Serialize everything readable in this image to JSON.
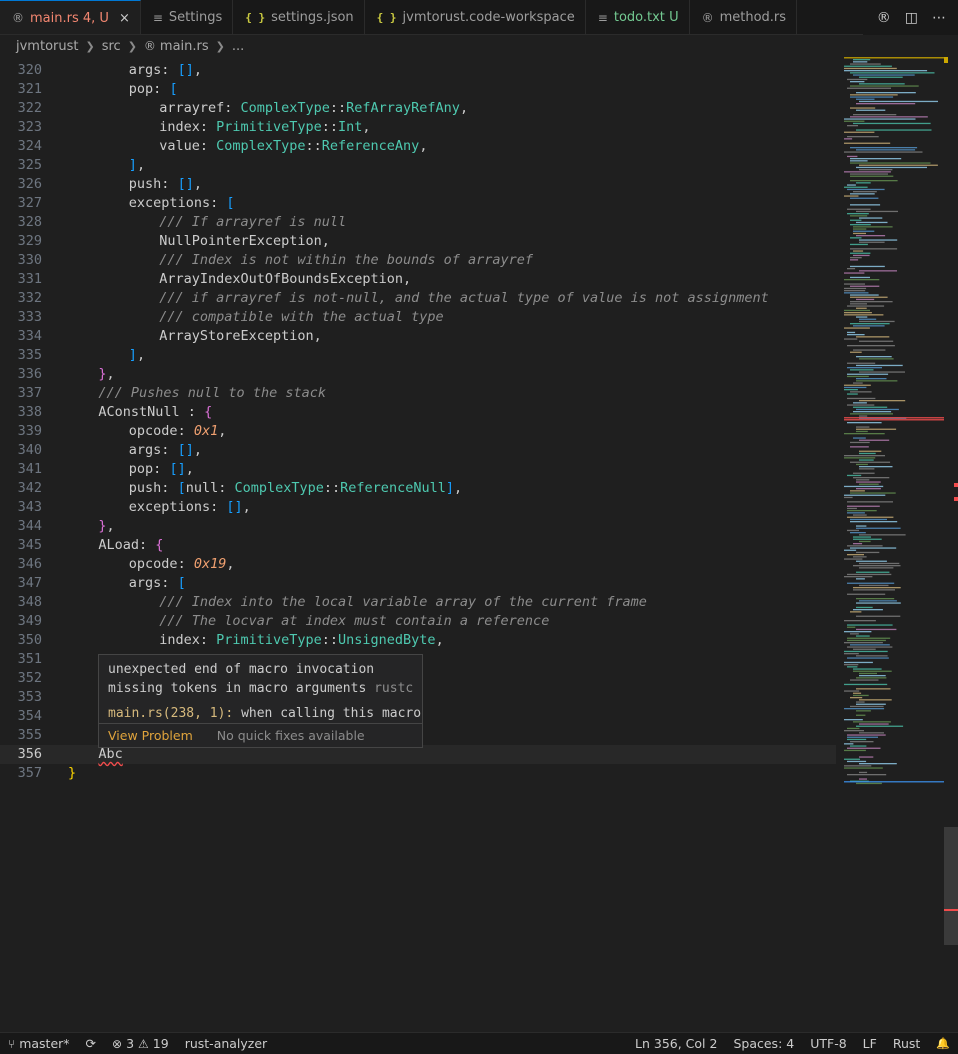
{
  "tabs": [
    {
      "icon": "rust-icon",
      "label": "main.rs",
      "badge": "4, U",
      "active": true,
      "close": "×"
    },
    {
      "icon": "settings-list-icon",
      "label": "Settings"
    },
    {
      "icon": "json-icon",
      "label": "settings.json"
    },
    {
      "icon": "json-icon",
      "label": "jvmtorust.code-workspace"
    },
    {
      "icon": "list-icon",
      "label": "todo.txt",
      "badge": "U"
    },
    {
      "icon": "rust-icon",
      "label": "method.rs"
    }
  ],
  "breadcrumb": {
    "items": [
      "jvmtorust",
      "src",
      "main.rs",
      "..."
    ]
  },
  "editor": {
    "current_line": 356,
    "lines": [
      {
        "n": "320",
        "indent": 8,
        "segs": [
          [
            "k",
            "args: "
          ],
          [
            "p2",
            "[]"
          ],
          [
            "k",
            ","
          ]
        ]
      },
      {
        "n": "321",
        "indent": 8,
        "segs": [
          [
            "k",
            "pop: "
          ],
          [
            "p2",
            "["
          ]
        ]
      },
      {
        "n": "322",
        "indent": 12,
        "segs": [
          [
            "k",
            "arrayref: "
          ],
          [
            "ty",
            "ComplexType"
          ],
          [
            "k",
            "::"
          ],
          [
            "ty",
            "RefArrayRefAny"
          ],
          [
            "k",
            ","
          ]
        ]
      },
      {
        "n": "323",
        "indent": 12,
        "segs": [
          [
            "k",
            "index: "
          ],
          [
            "ty",
            "PrimitiveType"
          ],
          [
            "k",
            "::"
          ],
          [
            "ty",
            "Int"
          ],
          [
            "k",
            ","
          ]
        ]
      },
      {
        "n": "324",
        "indent": 12,
        "segs": [
          [
            "k",
            "value: "
          ],
          [
            "ty",
            "ComplexType"
          ],
          [
            "k",
            "::"
          ],
          [
            "ty",
            "ReferenceAny"
          ],
          [
            "k",
            ","
          ]
        ]
      },
      {
        "n": "325",
        "indent": 8,
        "segs": [
          [
            "p2",
            "]"
          ],
          [
            "k",
            ","
          ]
        ]
      },
      {
        "n": "326",
        "indent": 8,
        "segs": [
          [
            "k",
            "push: "
          ],
          [
            "p2",
            "[]"
          ],
          [
            "k",
            ","
          ]
        ]
      },
      {
        "n": "327",
        "indent": 8,
        "segs": [
          [
            "k",
            "exceptions: "
          ],
          [
            "p2",
            "["
          ]
        ]
      },
      {
        "n": "328",
        "indent": 12,
        "segs": [
          [
            "cm",
            "/// If arrayref is null"
          ]
        ]
      },
      {
        "n": "329",
        "indent": 12,
        "segs": [
          [
            "k",
            "NullPointerException,"
          ]
        ]
      },
      {
        "n": "330",
        "indent": 12,
        "segs": [
          [
            "cm",
            "/// Index is not within the bounds of arrayref"
          ]
        ]
      },
      {
        "n": "331",
        "indent": 12,
        "segs": [
          [
            "k",
            "ArrayIndexOutOfBoundsException,"
          ]
        ]
      },
      {
        "n": "332",
        "indent": 12,
        "segs": [
          [
            "cm",
            "/// if arrayref is not-null, and the actual type of value is not assignment"
          ]
        ]
      },
      {
        "n": "333",
        "indent": 12,
        "segs": [
          [
            "cm",
            "/// compatible with the actual type"
          ]
        ]
      },
      {
        "n": "334",
        "indent": 12,
        "segs": [
          [
            "k",
            "ArrayStoreException,"
          ]
        ]
      },
      {
        "n": "335",
        "indent": 8,
        "segs": [
          [
            "p2",
            "]"
          ],
          [
            "k",
            ","
          ]
        ]
      },
      {
        "n": "336",
        "indent": 4,
        "segs": [
          [
            "p1",
            "}"
          ],
          [
            "k",
            ","
          ]
        ]
      },
      {
        "n": "337",
        "indent": 4,
        "segs": [
          [
            "cm",
            "/// Pushes null to the stack"
          ]
        ]
      },
      {
        "n": "338",
        "indent": 4,
        "segs": [
          [
            "k",
            "AConstNull : "
          ],
          [
            "p1",
            "{"
          ]
        ]
      },
      {
        "n": "339",
        "indent": 8,
        "segs": [
          [
            "k",
            "opcode: "
          ],
          [
            "num",
            "0x1"
          ],
          [
            "k",
            ","
          ]
        ]
      },
      {
        "n": "340",
        "indent": 8,
        "segs": [
          [
            "k",
            "args: "
          ],
          [
            "p2",
            "[]"
          ],
          [
            "k",
            ","
          ]
        ]
      },
      {
        "n": "341",
        "indent": 8,
        "segs": [
          [
            "k",
            "pop: "
          ],
          [
            "p2",
            "[]"
          ],
          [
            "k",
            ","
          ]
        ]
      },
      {
        "n": "342",
        "indent": 8,
        "segs": [
          [
            "k",
            "push: "
          ],
          [
            "p2",
            "["
          ],
          [
            "k",
            "null: "
          ],
          [
            "ty",
            "ComplexType"
          ],
          [
            "k",
            "::"
          ],
          [
            "ty",
            "ReferenceNull"
          ],
          [
            "p2",
            "]"
          ],
          [
            "k",
            ","
          ]
        ]
      },
      {
        "n": "343",
        "indent": 8,
        "segs": [
          [
            "k",
            "exceptions: "
          ],
          [
            "p2",
            "[]"
          ],
          [
            "k",
            ","
          ]
        ]
      },
      {
        "n": "344",
        "indent": 4,
        "segs": [
          [
            "p1",
            "}"
          ],
          [
            "k",
            ","
          ]
        ]
      },
      {
        "n": "345",
        "indent": 4,
        "segs": [
          [
            "k",
            "ALoad: "
          ],
          [
            "p1",
            "{"
          ]
        ]
      },
      {
        "n": "346",
        "indent": 8,
        "segs": [
          [
            "k",
            "opcode: "
          ],
          [
            "num",
            "0x19"
          ],
          [
            "k",
            ","
          ]
        ]
      },
      {
        "n": "347",
        "indent": 8,
        "segs": [
          [
            "k",
            "args: "
          ],
          [
            "p2",
            "["
          ]
        ]
      },
      {
        "n": "348",
        "indent": 12,
        "segs": [
          [
            "cm",
            "/// Index into the local variable array of the current frame"
          ]
        ]
      },
      {
        "n": "349",
        "indent": 12,
        "segs": [
          [
            "cm",
            "/// The locvar at index must contain a reference"
          ]
        ]
      },
      {
        "n": "350",
        "indent": 12,
        "segs": [
          [
            "k",
            "index: "
          ],
          [
            "ty",
            "PrimitiveType"
          ],
          [
            "k",
            "::"
          ],
          [
            "ty",
            "UnsignedByte"
          ],
          [
            "k",
            ","
          ]
        ]
      },
      {
        "n": "351",
        "indent": 0,
        "segs": []
      },
      {
        "n": "352",
        "indent": 0,
        "segs": []
      },
      {
        "n": "353",
        "indent": 0,
        "segs": []
      },
      {
        "n": "354",
        "indent": 0,
        "segs": []
      },
      {
        "n": "355",
        "indent": 0,
        "segs": []
      },
      {
        "n": "356",
        "indent": 4,
        "segs": [
          [
            "err",
            "Abc"
          ]
        ]
      },
      {
        "n": "357",
        "indent": 0,
        "segs": [
          [
            "gold",
            "}"
          ]
        ]
      }
    ]
  },
  "hover": {
    "message_line1": "unexpected end of macro invocation",
    "message_line2": "missing tokens in macro arguments",
    "source": "rustc",
    "location_link": "main.rs(238, 1):",
    "location_text": "when calling this macro",
    "view_problem": "View Problem",
    "no_fixes": "No quick fixes available"
  },
  "statusbar": {
    "branch": "master*",
    "errors": "3",
    "warnings": "19",
    "extension": "rust-analyzer",
    "position": "Ln 356, Col 2",
    "spaces": "Spaces: 4",
    "encoding": "UTF-8",
    "eol": "LF",
    "language": "Rust"
  },
  "icons": {
    "rust": "®",
    "json": "{ }",
    "list": "≡",
    "split": "◫",
    "more": "⋯",
    "branch": "⑂",
    "sync": "⟳",
    "error": "⊗",
    "warning": "⚠",
    "bell": "🔔"
  }
}
